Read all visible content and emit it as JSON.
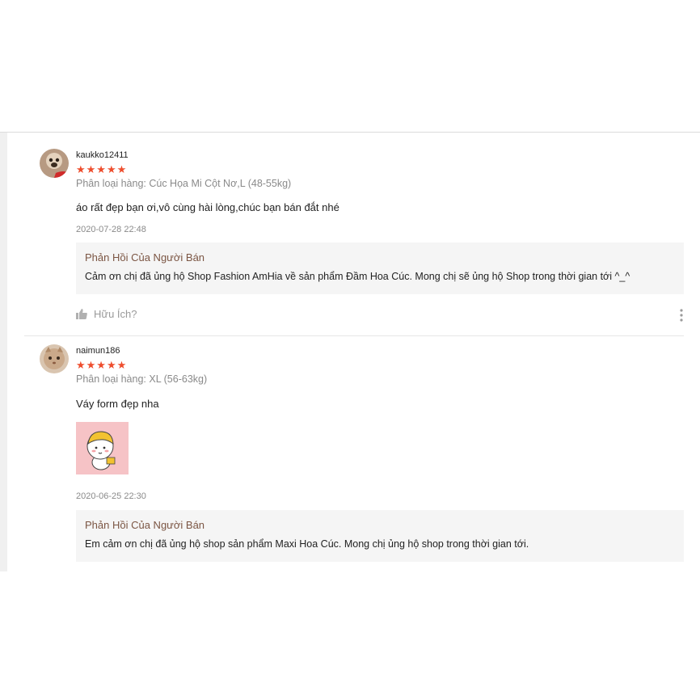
{
  "reviews": [
    {
      "username": "kaukko12411",
      "stars": "★★★★★",
      "rating": 5,
      "variation": "Phân loại hàng: Cúc Họa Mi Cột Nơ,L (48-55kg)",
      "comment": "áo rất đẹp bạn ơi,vô cùng hài lòng,chúc bạn bán đắt nhé",
      "date": "2020-07-28 22:48",
      "reply_title": "Phản Hồi Của Người Bán",
      "reply_text": "Cảm ơn chị đã ủng hộ Shop Fashion AmHia về sản phẩm Đầm Hoa Cúc. Mong chị sẽ ủng hộ Shop trong thời gian tới ^_^",
      "helpful_label": "Hữu Ích?"
    },
    {
      "username": "naimun186",
      "stars": "★★★★★",
      "rating": 5,
      "variation": "Phân loại hàng: XL (56-63kg)",
      "comment": "Váy form đẹp nha",
      "date": "2020-06-25 22:30",
      "reply_title": "Phản Hồi Của Người Bán",
      "reply_text": "Em cảm ơn chị đã ủng hộ shop sản phẩm Maxi Hoa Cúc. Mong chị ủng hộ shop trong thời gian tới."
    }
  ],
  "colors": {
    "star": "#ee4d2d",
    "reply_title": "#7b5543",
    "reply_bg": "#f5f5f5",
    "muted": "#8a8a8a"
  },
  "icons": {
    "helpful": "thumbs-up-icon",
    "more": "more-vertical-icon"
  }
}
